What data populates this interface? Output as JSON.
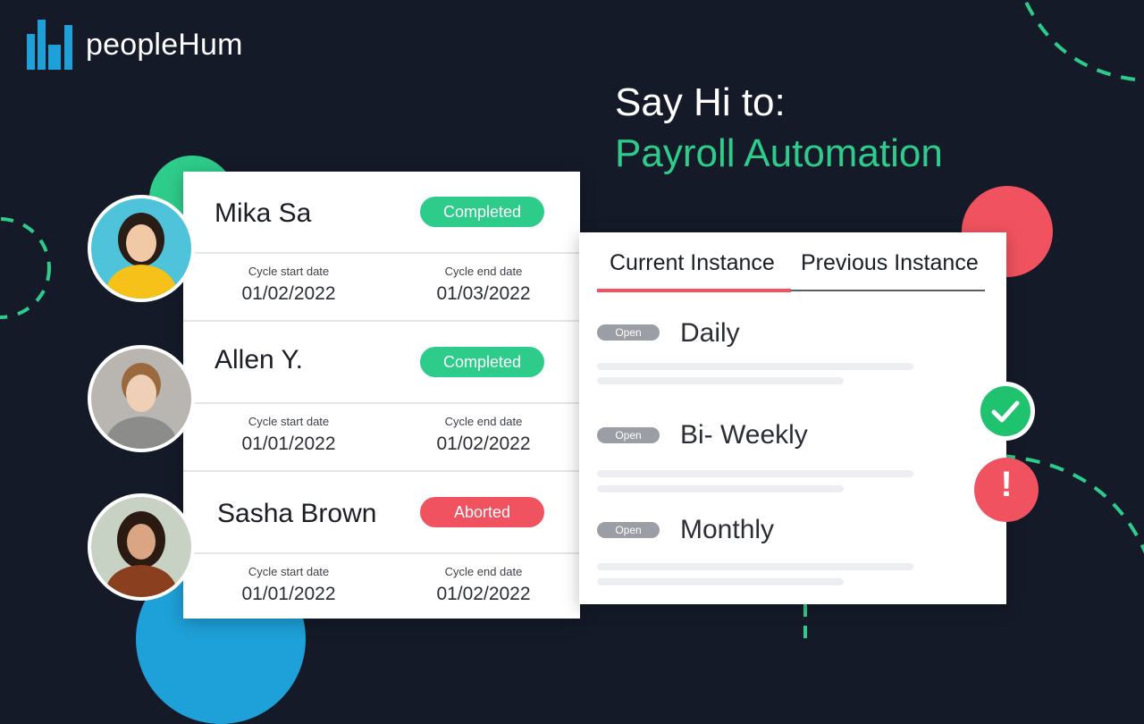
{
  "brand": {
    "name": "peopleHum",
    "logo_color": "#1ea0d8"
  },
  "headline": {
    "line1": "Say Hi to:",
    "line2": "Payroll Automation",
    "accent_color": "#2ecc8a"
  },
  "colors": {
    "background": "#151a29",
    "completed": "#2ecc8a",
    "aborted": "#f0535f",
    "tab_active": "#f0535f"
  },
  "payroll_cycles": [
    {
      "employee": "Mika Sa",
      "status": "Completed",
      "start_label": "Cycle start date",
      "start_date": "01/02/2022",
      "end_label": "Cycle end date",
      "end_date": "01/03/2022"
    },
    {
      "employee": "Allen Y.",
      "status": "Completed",
      "start_label": "Cycle start date",
      "start_date": "01/01/2022",
      "end_label": "Cycle end date",
      "end_date": "01/02/2022"
    },
    {
      "employee": "Sasha Brown",
      "status": "Aborted",
      "start_label": "Cycle start date",
      "start_date": "01/01/2022",
      "end_label": "Cycle end date",
      "end_date": "01/02/2022"
    }
  ],
  "instances": {
    "tabs": [
      {
        "label": "Current Instance",
        "active": true
      },
      {
        "label": "Previous Instance",
        "active": false
      }
    ],
    "items": [
      {
        "badge": "Open",
        "name": "Daily"
      },
      {
        "badge": "Open",
        "name": "Bi- Weekly"
      },
      {
        "badge": "Open",
        "name": "Monthly"
      }
    ]
  },
  "icons": {
    "success": "check-icon",
    "alert": "exclamation-icon"
  }
}
